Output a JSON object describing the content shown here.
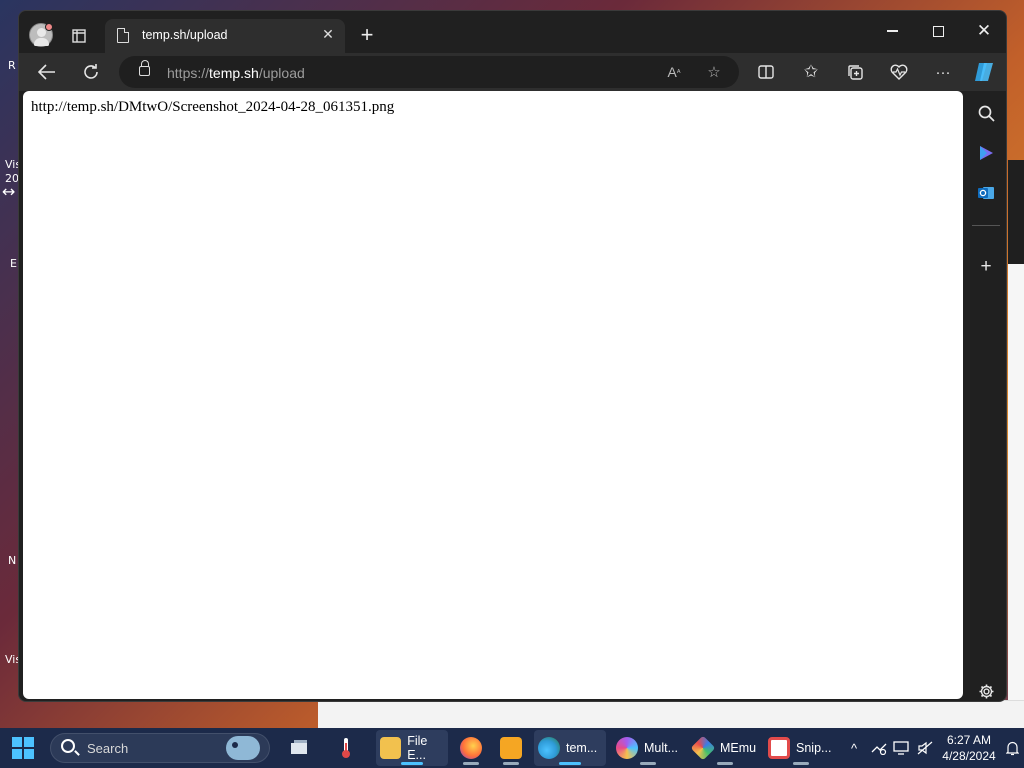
{
  "browser": {
    "tab": {
      "title": "temp.sh/upload"
    },
    "address": {
      "scheme": "https://",
      "host": "temp.sh",
      "path": "/upload"
    },
    "page": {
      "text": "http://temp.sh/DMtwO/Screenshot_2024-04-28_061351.png"
    },
    "accent_color": "#4cc2ff"
  },
  "desktop": {
    "fragments": [
      "R",
      "Vis",
      "20",
      "E",
      "N",
      "Vis"
    ]
  },
  "taskbar": {
    "search_placeholder": "Search",
    "apps": [
      {
        "name": "file-explorer",
        "label": "File E...",
        "color": "#f2c14e"
      },
      {
        "name": "firefox",
        "label": "",
        "color": "#ff7139"
      },
      {
        "name": "media-player",
        "label": "",
        "color": "#f5a623"
      },
      {
        "name": "edge",
        "label": "tem...",
        "color": "#2f9bd8"
      },
      {
        "name": "multi",
        "label": "Mult...",
        "color": "#a45cf0"
      },
      {
        "name": "memu",
        "label": "MEmu",
        "color": "#3b7be8"
      },
      {
        "name": "snipping-tool",
        "label": "Snip...",
        "color": "#e24b4b"
      }
    ],
    "clock": {
      "time": "6:27 AM",
      "date": "4/28/2024"
    }
  }
}
